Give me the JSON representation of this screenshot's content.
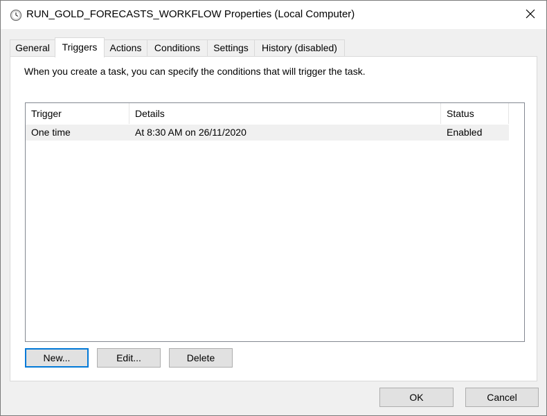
{
  "window": {
    "title": "RUN_GOLD_FORECASTS_WORKFLOW Properties (Local Computer)"
  },
  "tabs": [
    {
      "label": "General"
    },
    {
      "label": "Triggers"
    },
    {
      "label": "Actions"
    },
    {
      "label": "Conditions"
    },
    {
      "label": "Settings"
    },
    {
      "label": "History (disabled)"
    }
  ],
  "active_tab": "Triggers",
  "triggers_panel": {
    "intro": "When you create a task, you can specify the conditions that will trigger the task.",
    "columns": [
      "Trigger",
      "Details",
      "Status"
    ],
    "rows": [
      {
        "trigger": "One time",
        "details": "At 8:30 AM on 26/11/2020",
        "status": "Enabled"
      }
    ],
    "buttons": {
      "new": "New...",
      "edit": "Edit...",
      "delete": "Delete"
    }
  },
  "footer": {
    "ok": "OK",
    "cancel": "Cancel"
  },
  "icons": {
    "title": "clock-icon",
    "close": "close-icon"
  },
  "colors": {
    "default_button_border": "#0078d7",
    "selected_row": "#f0f0f0"
  }
}
